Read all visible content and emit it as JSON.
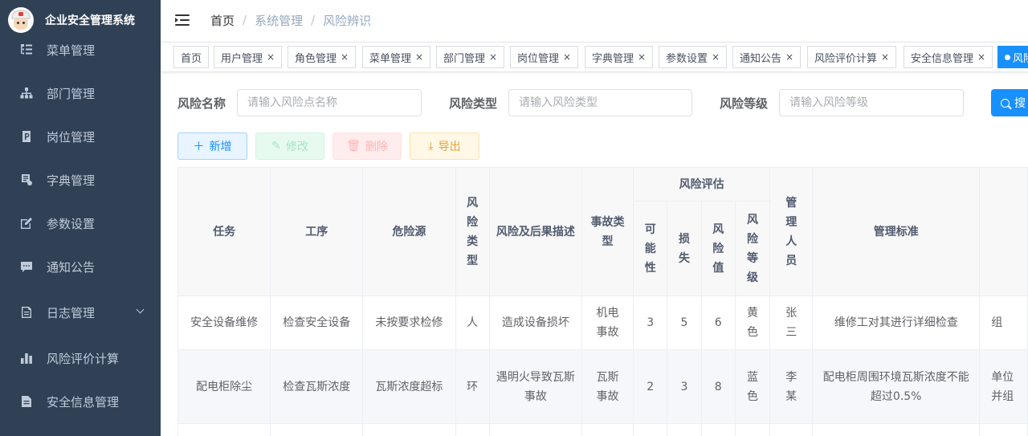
{
  "app": {
    "title": "企业安全管理系统"
  },
  "sidebar": {
    "items": [
      {
        "label": "菜单管理",
        "icon": "tree-table-icon"
      },
      {
        "label": "部门管理",
        "icon": "org-tree-icon"
      },
      {
        "label": "岗位管理",
        "icon": "post-icon"
      },
      {
        "label": "字典管理",
        "icon": "dict-icon"
      },
      {
        "label": "参数设置",
        "icon": "edit-icon"
      },
      {
        "label": "通知公告",
        "icon": "message-icon"
      },
      {
        "label": "日志管理",
        "icon": "log-icon"
      },
      {
        "label": "风险评价计算",
        "icon": "bar-chart-icon"
      },
      {
        "label": "安全信息管理",
        "icon": "document-icon"
      }
    ]
  },
  "breadcrumb": {
    "home": "首页",
    "level1": "系统管理",
    "level2": "风险辨识",
    "separator": "/"
  },
  "tags": [
    {
      "label": "首页"
    },
    {
      "label": "用户管理"
    },
    {
      "label": "角色管理"
    },
    {
      "label": "菜单管理"
    },
    {
      "label": "部门管理"
    },
    {
      "label": "岗位管理"
    },
    {
      "label": "字典管理"
    },
    {
      "label": "参数设置"
    },
    {
      "label": "通知公告"
    },
    {
      "label": "风险评价计算"
    },
    {
      "label": "安全信息管理"
    },
    {
      "label": "风险"
    }
  ],
  "tag_close": "×",
  "search": {
    "name_label": "风险名称",
    "name_placeholder": "请输入风险点名称",
    "type_label": "风险类型",
    "type_placeholder": "请输入风险类型",
    "level_label": "风险等级",
    "level_placeholder": "请输入风险等级",
    "button_label": "搜"
  },
  "actions": {
    "add": "新增",
    "edit": "修改",
    "delete": "删除",
    "export": "导出"
  },
  "table": {
    "headers": {
      "task": "任务",
      "process": "工序",
      "hazard": "危险源",
      "risk_type": "风险类型",
      "risk_desc": "风险及后果描述",
      "accident_type": "事故类型",
      "evaluation": "风险评估",
      "possibility": "可能性",
      "loss": "损失",
      "risk_value": "风险值",
      "risk_level": "风险等级",
      "manager": "管理人员",
      "standard": "管理标准"
    },
    "rows": [
      {
        "task": "安全设备维修",
        "process": "检查安全设备",
        "hazard": "未按要求检修",
        "risk_type": "人",
        "risk_desc": "造成设备损坏",
        "accident_type": "机电事故",
        "possibility": "3",
        "loss": "5",
        "risk_value": "6",
        "risk_level": "黄色",
        "manager": "张三",
        "standard": "维修工对其进行详细检查",
        "extra": "组"
      },
      {
        "task": "配电柜除尘",
        "process": "检查瓦斯浓度",
        "hazard": "瓦斯浓度超标",
        "risk_type": "环",
        "risk_desc": "遇明火导致瓦斯事故",
        "accident_type": "瓦斯事故",
        "possibility": "2",
        "loss": "3",
        "risk_value": "8",
        "risk_level": "蓝色",
        "manager": "李某",
        "standard": "配电柜周围环境瓦斯浓度不能超过0.5%",
        "extra": "单位并组"
      }
    ]
  }
}
